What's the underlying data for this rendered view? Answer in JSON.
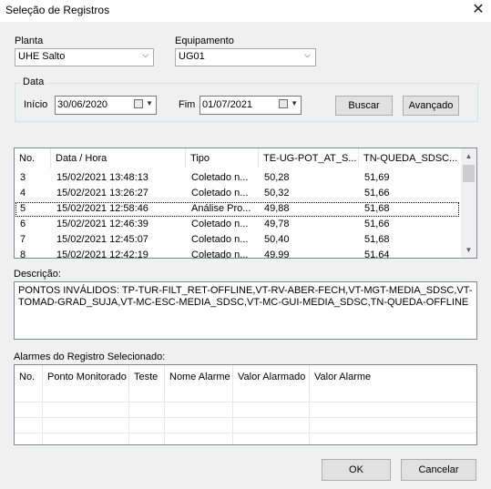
{
  "window": {
    "title": "Seleção de Registros",
    "close_glyph": "✕"
  },
  "filters": {
    "planta_label": "Planta",
    "planta_value": "UHE Salto",
    "equipamento_label": "Equipamento",
    "equipamento_value": "UG01"
  },
  "date": {
    "group_label": "Data",
    "start_label": "Início",
    "start_value": "30/06/2020",
    "end_label": "Fim",
    "end_value": "01/07/2021"
  },
  "buttons": {
    "search": "Buscar",
    "advanced": "Avançado",
    "ok": "OK",
    "cancel": "Cancelar"
  },
  "records": {
    "columns": [
      "No.",
      "Data / Hora",
      "Tipo",
      "TE-UG-POT_AT_S...",
      "TN-QUEDA_SDSC..."
    ],
    "rows": [
      [
        "3",
        "15/02/2021 13:48:13",
        "Coletado n...",
        "50,28",
        "51,69"
      ],
      [
        "4",
        "15/02/2021 13:26:27",
        "Coletado n...",
        "50,32",
        "51,66"
      ],
      [
        "5",
        "15/02/2021 12:58:46",
        "Análise Pro...",
        "49,88",
        "51,68"
      ],
      [
        "6",
        "15/02/2021 12:46:39",
        "Coletado n...",
        "49,78",
        "51,66"
      ],
      [
        "7",
        "15/02/2021 12:45:07",
        "Coletado n...",
        "50,40",
        "51,68"
      ],
      [
        "8",
        "15/02/2021 12:42:19",
        "Coletado n...",
        "49,99",
        "51,64"
      ]
    ]
  },
  "description": {
    "label": "Descrição:",
    "text": "PONTOS  INVÁLIDOS: TP-TUR-FILT_RET-OFFLINE,VT-RV-ABER-FECH,VT-MGT-MEDIA_SDSC,VT-TOMAD-GRAD_SUJA,VT-MC-ESC-MEDIA_SDSC,VT-MC-GUI-MEDIA_SDSC,TN-QUEDA-OFFLINE"
  },
  "alarms": {
    "label": "Alarmes do Registro Selecionado:",
    "columns": [
      "No.",
      "Ponto Monitorado",
      "Teste",
      "Nome Alarme",
      "Valor Alarmado",
      "Valor Alarme"
    ]
  }
}
